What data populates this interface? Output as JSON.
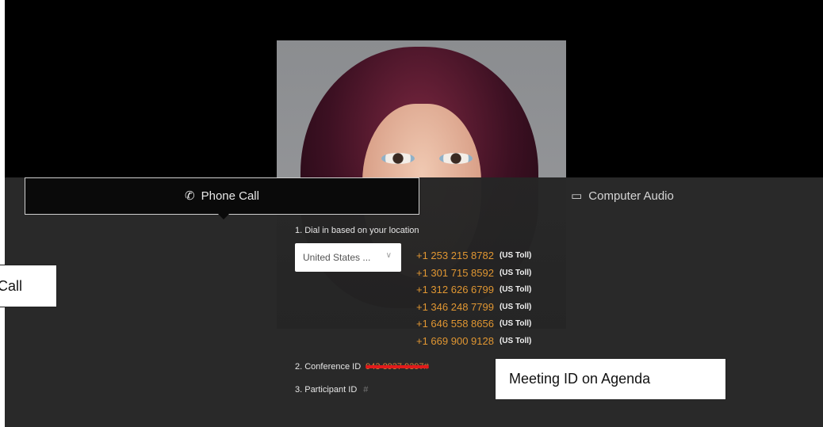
{
  "tabs": {
    "phone_call": {
      "label": "Phone Call",
      "icon": "phone-icon"
    },
    "computer_audio": {
      "label": "Computer Audio",
      "icon": "laptop-icon"
    }
  },
  "dial_in": {
    "heading": "1. Dial in based on your location",
    "location_select": {
      "value": "United States ..."
    },
    "numbers": [
      {
        "number": "+1 253 215 8782",
        "type": "(US Toll)"
      },
      {
        "number": "+1 301 715 8592",
        "type": "(US Toll)"
      },
      {
        "number": "+1 312 626 6799",
        "type": "(US Toll)"
      },
      {
        "number": "+1 346 248 7799",
        "type": "(US Toll)"
      },
      {
        "number": "+1 646 558 8656",
        "type": "(US Toll)"
      },
      {
        "number": "+1 669 900 9128",
        "type": "(US Toll)"
      }
    ]
  },
  "conference": {
    "label": "2. Conference ID",
    "value": "943 8937 9397#"
  },
  "participant": {
    "label": "3. Participant ID",
    "value": "#"
  },
  "annotations": {
    "left": "Call",
    "right": "Meeting ID on Agenda"
  },
  "colors": {
    "number": "#e09632",
    "panel": "#1e1e1e",
    "strike": "#e21a1a"
  }
}
